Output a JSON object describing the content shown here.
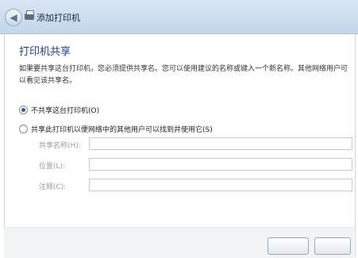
{
  "window": {
    "title": "添加打印机"
  },
  "page": {
    "heading": "打印机共享",
    "description": "如果要共享这台打印机，您必须提供共享名。您可以使用建议的名称或键入一个新名称。其他网络用户可以看见该共享名。"
  },
  "options": {
    "no_share": {
      "label": "不共享这台打印机(O)",
      "selected": true
    },
    "share": {
      "label": "共享此打印机以便网络中的其他用户可以找到并使用它(S)",
      "selected": false
    }
  },
  "fields": [
    {
      "label": "共享名称(H):",
      "value": ""
    },
    {
      "label": "位置(L):",
      "value": ""
    },
    {
      "label": "注释(C):",
      "value": ""
    }
  ],
  "buttons": {
    "next": "",
    "cancel": ""
  }
}
